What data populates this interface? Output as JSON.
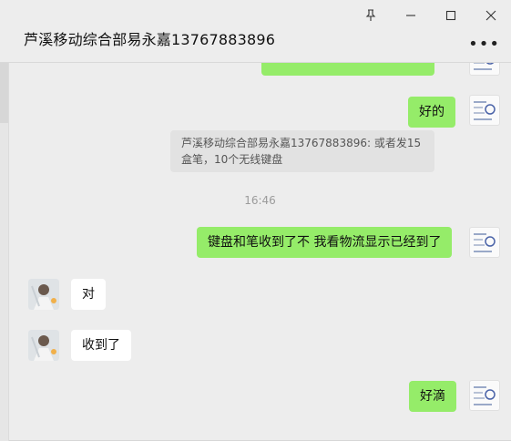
{
  "window": {
    "pin_icon": "pin-icon",
    "minimize_icon": "minimize-icon",
    "maximize_icon": "maximize-icon",
    "close_icon": "close-icon"
  },
  "header": {
    "title": "芦溪移动综合部易永嘉13767883896",
    "more_label": "•••"
  },
  "messages": {
    "m0_text": "好的",
    "quote_text": "芦溪移动综合部易永嘉13767883896: 或者发15盒笔，10个无线键盘",
    "time": "16:46",
    "m1_text": "键盘和笔收到了不  我看物流显示已经到了",
    "m2_text": "对",
    "m3_text": "收到了",
    "m4_text": "好滴"
  },
  "colors": {
    "self_bubble": "#95ec69",
    "other_bubble": "#ffffff",
    "background": "#ededed"
  }
}
